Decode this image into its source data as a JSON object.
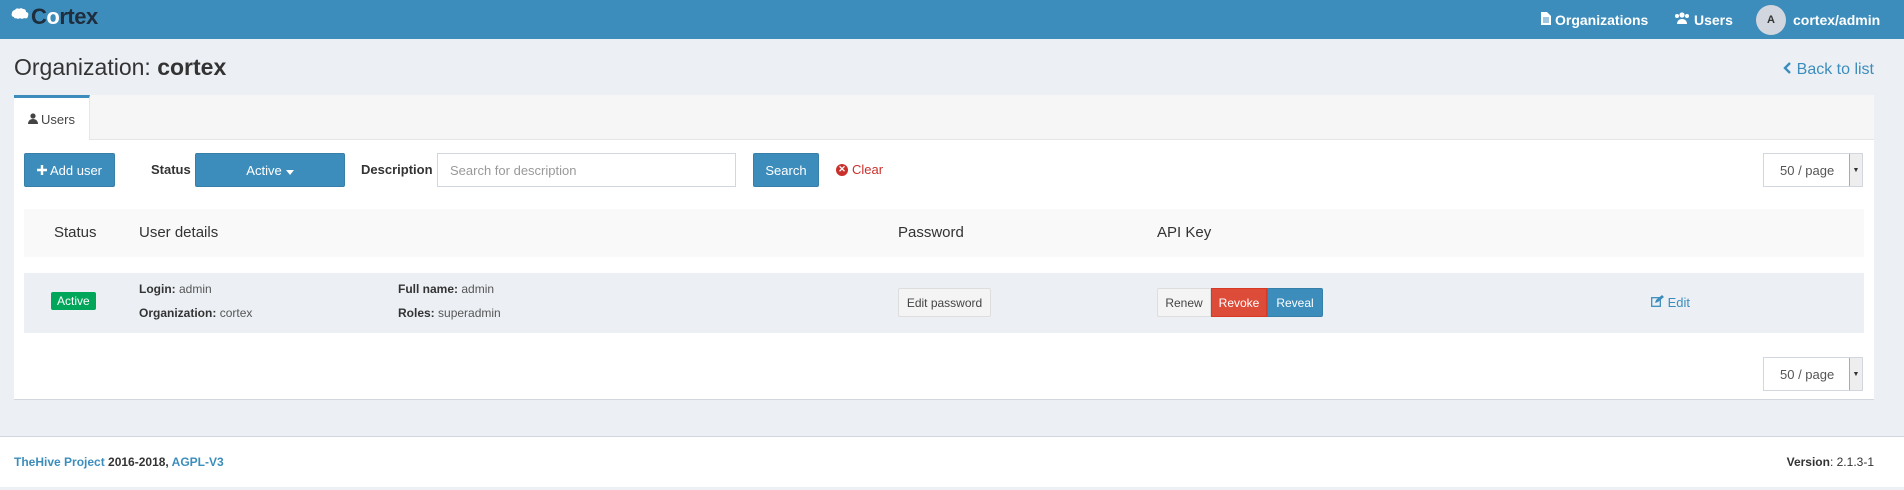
{
  "topbar": {
    "logo_text_pre": "C",
    "logo_text_o": "o",
    "logo_text_post": "rtex",
    "nav": {
      "organizations": "Organizations",
      "users": "Users",
      "user_avatar": "A",
      "user_name": "cortex/admin"
    }
  },
  "header": {
    "title_prefix": "Organization: ",
    "title_name": "cortex",
    "back_label": "Back to list"
  },
  "tabs": [
    {
      "label": "Users"
    }
  ],
  "toolbar": {
    "add_user_label": "Add user",
    "status_label": "Status",
    "status_value": "Active",
    "description_label": "Description",
    "description_placeholder": "Search for description",
    "description_value": "",
    "search_label": "Search",
    "clear_label": "Clear",
    "page_size": "50 / page"
  },
  "table": {
    "headers": [
      "Status",
      "User details",
      "Password",
      "API Key"
    ],
    "rows": [
      {
        "status": "Active",
        "login_label": "Login:",
        "login": "admin",
        "org_label": "Organization:",
        "organization": "cortex",
        "fullname_label": "Full name:",
        "fullname": "admin",
        "roles_label": "Roles:",
        "roles": "superadmin",
        "edit_password_label": "Edit password",
        "renew_label": "Renew",
        "revoke_label": "Revoke",
        "reveal_label": "Reveal",
        "edit_label": "Edit"
      }
    ]
  },
  "bottom_pager": {
    "page_size": "50 / page"
  },
  "footer": {
    "project_link": "TheHive Project",
    "years": " 2016-2018, ",
    "license_link": "AGPL-V3",
    "version_label": "Version",
    "version": ": 2.1.3-1"
  },
  "colors": {
    "primary": "#3c8dbc",
    "danger": "#dd4b39",
    "success": "#00a65a",
    "background": "#ecf0f5"
  },
  "icons": [
    "brain-icon",
    "file-icon",
    "users-icon",
    "user-icon",
    "plus-icon",
    "caret-down-icon",
    "times-circle-icon",
    "chevron-left-icon",
    "edit-icon"
  ]
}
